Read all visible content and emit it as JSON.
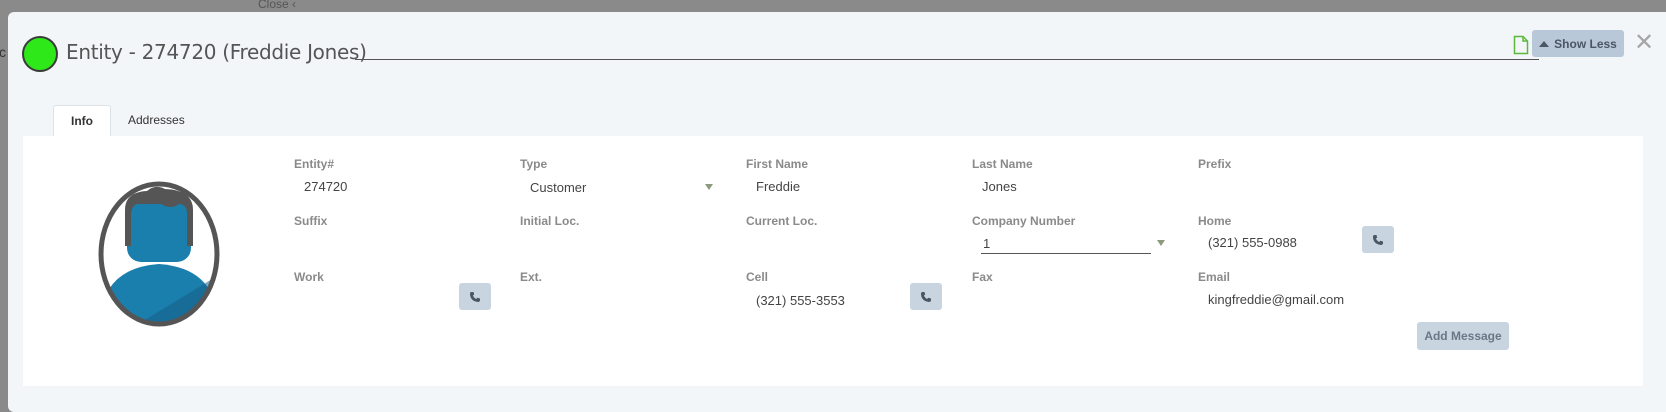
{
  "backdrop": {
    "close_label": "Close ‹",
    "partial_letter": "c"
  },
  "header": {
    "title": "Entity - 274720 (Freddie Jones)",
    "status_color": "#2ee81a",
    "show_less_label": "Show Less",
    "icons": {
      "document": "document-icon",
      "close": "close-icon",
      "caret": "caret-up-icon"
    }
  },
  "tabs": [
    {
      "label": "Info",
      "active": true
    },
    {
      "label": "Addresses",
      "active": false
    }
  ],
  "fields": {
    "entity_no": {
      "label": "Entity#",
      "value": "274720"
    },
    "type": {
      "label": "Type",
      "value": "Customer"
    },
    "first_name": {
      "label": "First Name",
      "value": "Freddie"
    },
    "last_name": {
      "label": "Last Name",
      "value": "Jones"
    },
    "prefix": {
      "label": "Prefix",
      "value": ""
    },
    "suffix": {
      "label": "Suffix",
      "value": ""
    },
    "initial_loc": {
      "label": "Initial Loc.",
      "value": ""
    },
    "current_loc": {
      "label": "Current Loc.",
      "value": ""
    },
    "company_number": {
      "label": "Company Number",
      "value": "1"
    },
    "home": {
      "label": "Home",
      "value": "(321) 555-0988"
    },
    "work": {
      "label": "Work",
      "value": ""
    },
    "ext": {
      "label": "Ext.",
      "value": ""
    },
    "cell": {
      "label": "Cell",
      "value": "(321) 555-3553"
    },
    "fax": {
      "label": "Fax",
      "value": ""
    },
    "email": {
      "label": "Email",
      "value": "kingfreddie@gmail.com"
    }
  },
  "actions": {
    "add_message_label": "Add Message"
  },
  "colors": {
    "accent_button": "#c8d4e0",
    "avatar_blue": "#1b7fae",
    "avatar_dark": "#555555"
  }
}
